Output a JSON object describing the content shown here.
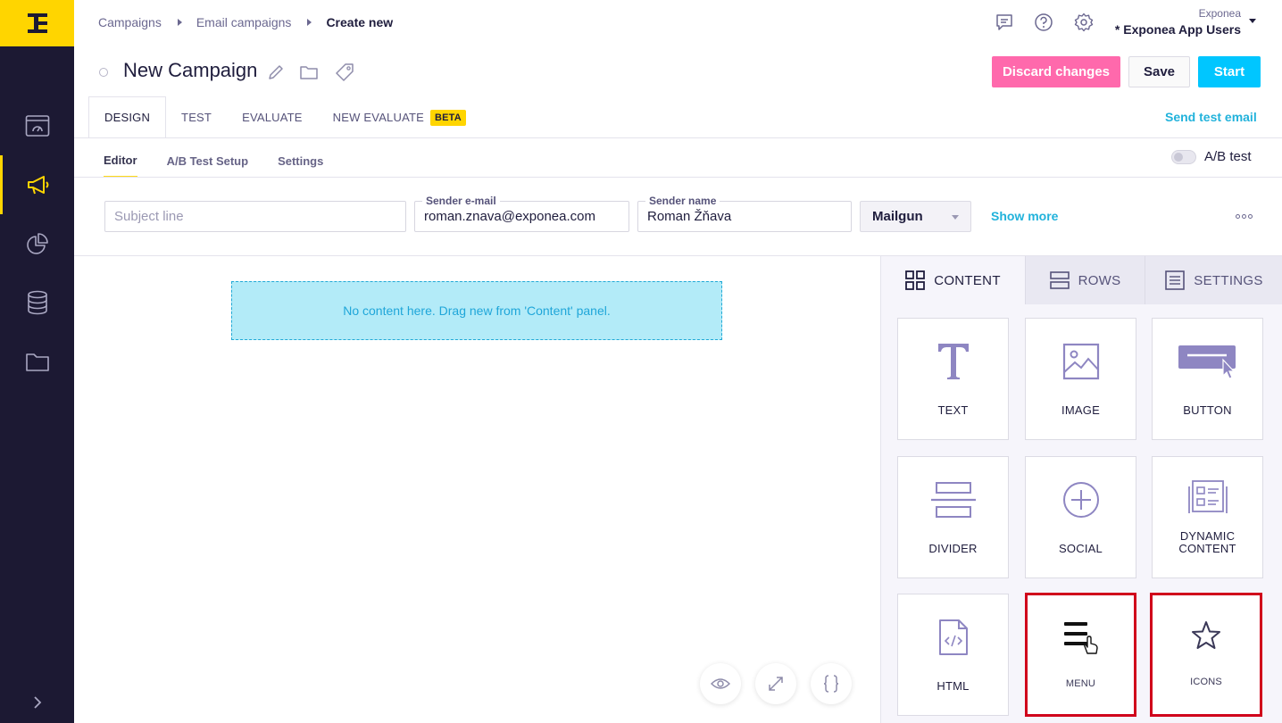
{
  "breadcrumb": {
    "items": [
      "Campaigns",
      "Email campaigns"
    ],
    "current": "Create new"
  },
  "account": {
    "org": "Exponea",
    "project": "* Exponea App Users"
  },
  "campaign": {
    "title": "New Campaign"
  },
  "buttons": {
    "discard": "Discard changes",
    "save": "Save",
    "start": "Start"
  },
  "tabs": [
    "DESIGN",
    "TEST",
    "EVALUATE",
    "NEW EVALUATE"
  ],
  "beta_badge": "BETA",
  "send_test": "Send test email",
  "subtabs": [
    "Editor",
    "A/B Test Setup",
    "Settings"
  ],
  "ab_toggle": {
    "label": "A/B test",
    "on": false
  },
  "fields": {
    "subject": {
      "placeholder": "Subject line",
      "value": ""
    },
    "sender_email": {
      "label": "Sender e-mail",
      "value": "roman.znava@exponea.com"
    },
    "sender_name": {
      "label": "Sender name",
      "value": "Roman Žňava"
    }
  },
  "provider": {
    "selected": "Mailgun"
  },
  "show_more": "Show more",
  "dropzone": "No content here. Drag new from 'Content' panel.",
  "panel": {
    "tabs": [
      "CONTENT",
      "ROWS",
      "SETTINGS"
    ],
    "tiles": [
      {
        "label": "TEXT",
        "icon": "text-icon"
      },
      {
        "label": "IMAGE",
        "icon": "image-icon"
      },
      {
        "label": "BUTTON",
        "icon": "button-icon"
      },
      {
        "label": "DIVIDER",
        "icon": "divider-icon"
      },
      {
        "label": "SOCIAL",
        "icon": "social-icon"
      },
      {
        "label": "DYNAMIC CONTENT",
        "icon": "dynamic-content-icon"
      },
      {
        "label": "HTML",
        "icon": "html-icon"
      },
      {
        "label": "MENU",
        "icon": "menu-icon"
      },
      {
        "label": "ICONS",
        "icon": "star-icon"
      }
    ]
  },
  "colors": {
    "brand_yellow": "#ffd500",
    "sidebar": "#1c1933",
    "accent_cyan": "#00c6ff",
    "discard_pink": "#ff69ac",
    "highlight_red": "#d0021b"
  }
}
